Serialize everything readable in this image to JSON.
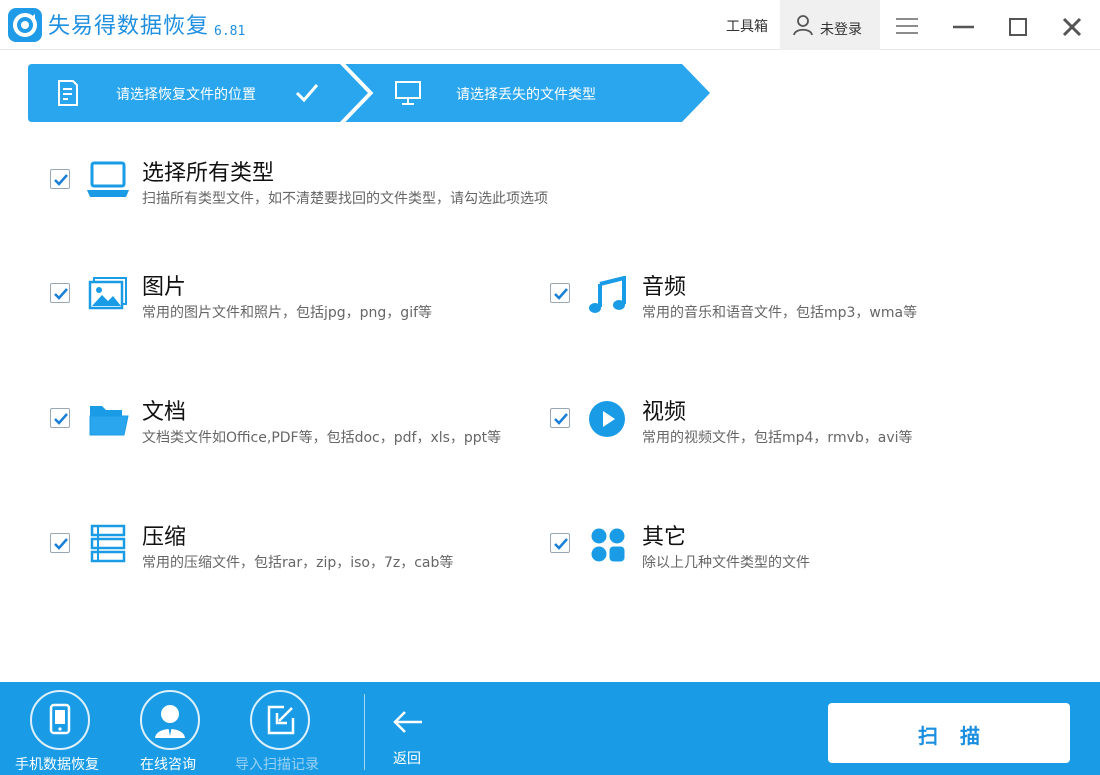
{
  "app": {
    "title": "失易得数据恢复",
    "version": "6.81"
  },
  "header": {
    "toolbox_label": "工具箱",
    "login_label": "未登录"
  },
  "steps": [
    {
      "label": "请选择恢复文件的位置",
      "state": "done"
    },
    {
      "label": "请选择丢失的文件类型",
      "state": "active"
    }
  ],
  "options": {
    "all": {
      "title": "选择所有类型",
      "desc": "扫描所有类型文件，如不清楚要找回的文件类型，请勾选此项选项",
      "checked": true,
      "icon": "laptop-icon"
    },
    "images": {
      "title": "图片",
      "desc": "常用的图片文件和照片，包括jpg，png，gif等",
      "checked": true,
      "icon": "image-icon"
    },
    "audio": {
      "title": "音频",
      "desc": "常用的音乐和语音文件，包括mp3，wma等",
      "checked": true,
      "icon": "music-note-icon"
    },
    "docs": {
      "title": "文档",
      "desc": "文档类文件如Office,PDF等，包括doc，pdf，xls，ppt等",
      "checked": true,
      "icon": "folder-icon"
    },
    "video": {
      "title": "视频",
      "desc": "常用的视频文件，包括mp4，rmvb，avi等",
      "checked": true,
      "icon": "play-icon"
    },
    "archive": {
      "title": "压缩",
      "desc": "常用的压缩文件，包括rar，zip，iso，7z，cab等",
      "checked": true,
      "icon": "archive-icon"
    },
    "other": {
      "title": "其它",
      "desc": "除以上几种文件类型的文件",
      "checked": true,
      "icon": "grid-icon"
    }
  },
  "bottom": {
    "phone_recovery": "手机数据恢复",
    "online_consult": "在线咨询",
    "import_records": "导入扫描记录",
    "back": "返回",
    "scan": "扫描"
  },
  "colors": {
    "accent": "#1a9be6",
    "step_bg": "#2aa6ef"
  }
}
